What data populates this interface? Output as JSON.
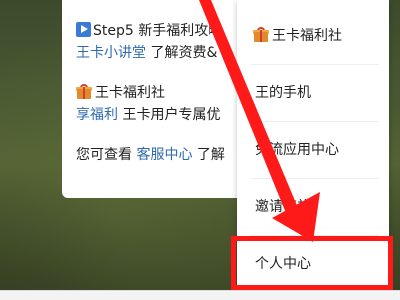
{
  "chat_card": {
    "step_line_prefix": "Step5 新手福利攻略",
    "tutorial_link": "王卡小讲堂",
    "tutorial_text": " 了解资费&",
    "welfare_title": "王卡福利社",
    "welfare_link": "享福利",
    "welfare_text": " 王卡用户专属优",
    "service_prefix": "您可查看 ",
    "service_link": "客服中心",
    "service_suffix": " 了解"
  },
  "menu": {
    "items": [
      {
        "label": "王卡福利社",
        "icon": "gift-icon"
      },
      {
        "label": "王的手机"
      },
      {
        "label": "免流应用中心"
      },
      {
        "label": "邀请有礼"
      },
      {
        "label": "个人中心"
      }
    ]
  },
  "annotation": {
    "color": "#ff1a1a",
    "highlighted_item": "个人中心"
  },
  "icons": {
    "step": "play-icon",
    "gift": "gift-icon"
  }
}
